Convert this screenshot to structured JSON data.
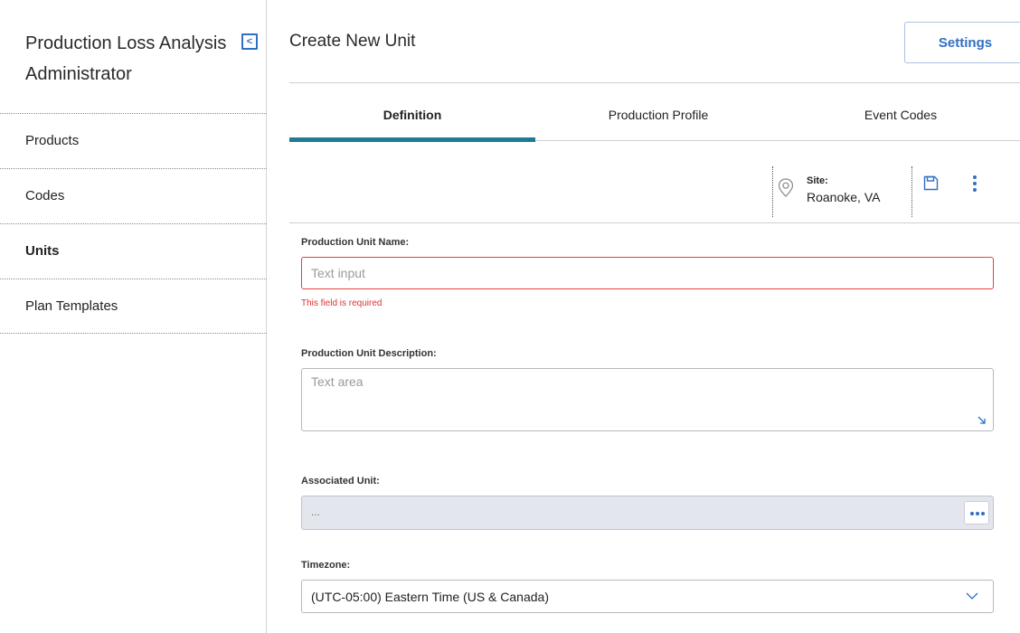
{
  "sidebar": {
    "title": "Production Loss Analysis Administrator",
    "collapse_glyph": "<",
    "items": [
      {
        "label": "Products"
      },
      {
        "label": "Codes"
      },
      {
        "label": "Units"
      },
      {
        "label": "Plan Templates"
      }
    ],
    "active_item": "Units"
  },
  "header": {
    "title": "Create New Unit",
    "settings_label": "Settings"
  },
  "tabs": [
    {
      "label": "Definition"
    },
    {
      "label": "Production Profile"
    },
    {
      "label": "Event Codes"
    }
  ],
  "active_tab": "Definition",
  "toolbar": {
    "site_label": "Site:",
    "site_value": "Roanoke, VA",
    "icons": [
      "location-pin-icon",
      "save-icon",
      "more-vertical-icon"
    ]
  },
  "form": {
    "name_label": "Production Unit Name:",
    "name_placeholder": "Text input",
    "name_error": "This field is required",
    "description_label": "Production Unit Description:",
    "description_placeholder": "Text area",
    "associated_label": "Associated Unit:",
    "associated_value": "...",
    "timezone_label": "Timezone:",
    "timezone_value": "(UTC-05:00) Eastern Time (US & Canada)"
  },
  "colors": {
    "accent": "#2f6fc6",
    "tab_underline": "#1f7b8f",
    "error": "#e03030"
  }
}
